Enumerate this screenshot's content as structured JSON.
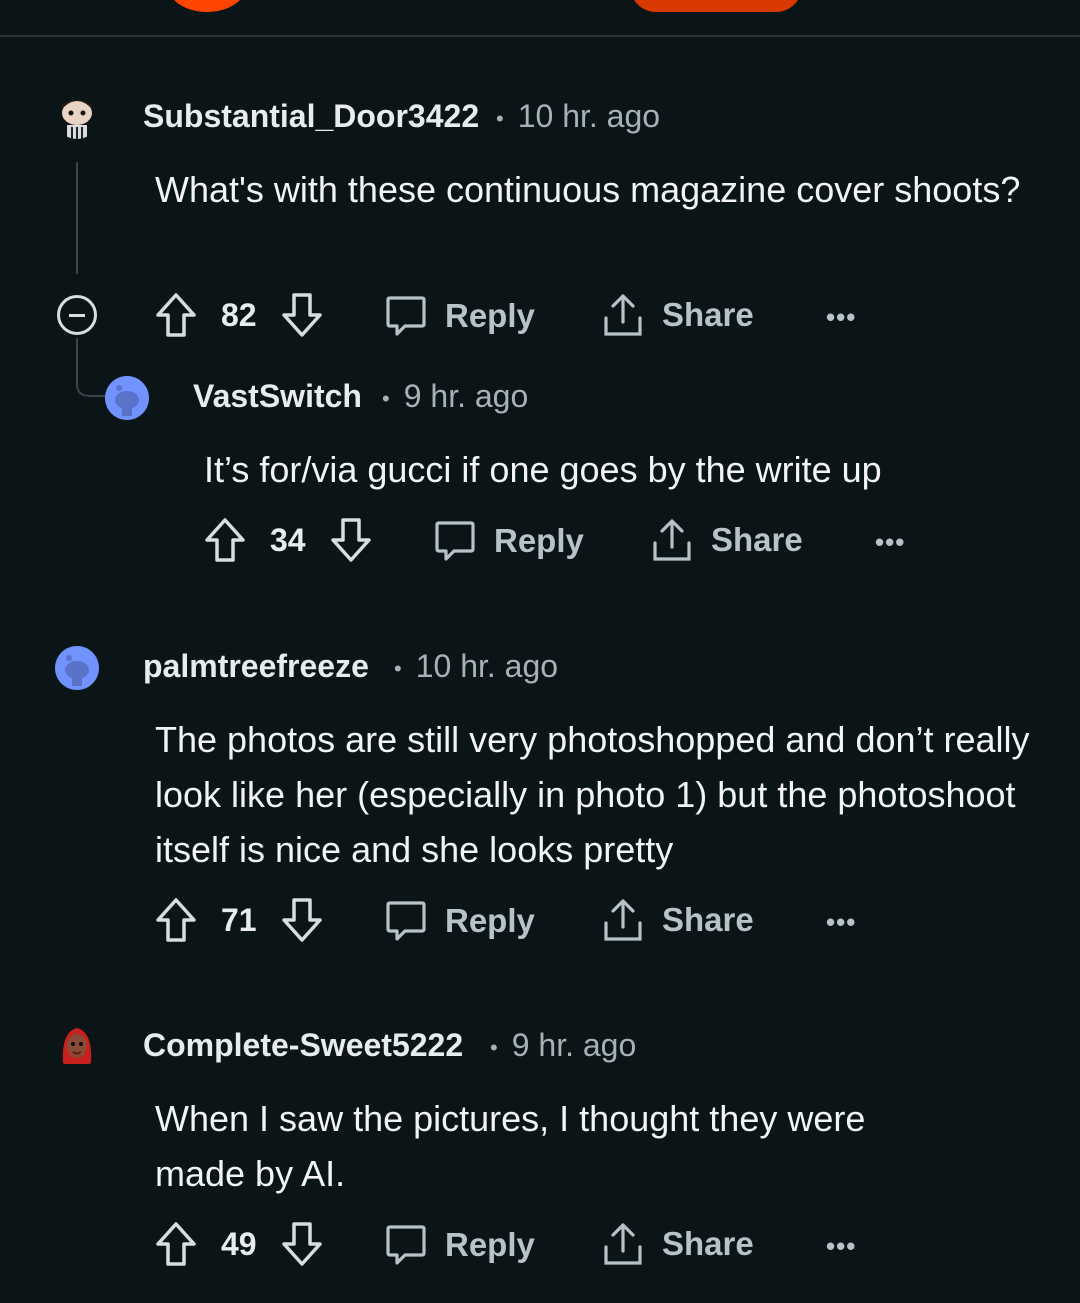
{
  "comments": [
    {
      "username": "Substantial_Door3422",
      "time": "10 hr. ago",
      "text": "What's with these continuous magazine cover shoots?",
      "votes": "82",
      "reply_label": "Reply",
      "share_label": "Share"
    },
    {
      "username": "VastSwitch",
      "time": "9 hr. ago",
      "text": "It’s for/via gucci if one goes by the write up",
      "votes": "34",
      "reply_label": "Reply",
      "share_label": "Share"
    },
    {
      "username": "palmtreefreeze",
      "time": "10 hr. ago",
      "text": "The photos are still very photoshopped and don’t really look like her (especially in photo 1) but the photoshoot itself is nice and she looks pretty",
      "votes": "71",
      "reply_label": "Reply",
      "share_label": "Share"
    },
    {
      "username": "Complete-Sweet5222",
      "time": "9 hr. ago",
      "text": "When I saw the pictures, I thought they were made by AI.",
      "votes": "49",
      "reply_label": "Reply",
      "share_label": "Share"
    }
  ],
  "icons": {
    "upvote": "arrow-up-outline",
    "downvote": "arrow-down-outline",
    "reply": "speech-bubble",
    "share": "share-upload",
    "more": "ellipsis",
    "collapse": "minus-circle"
  },
  "colors": {
    "background": "#0b1416",
    "text": "#f2f4f5",
    "muted": "#a7b2b7",
    "accent": "#ff4500"
  },
  "separator": "•"
}
